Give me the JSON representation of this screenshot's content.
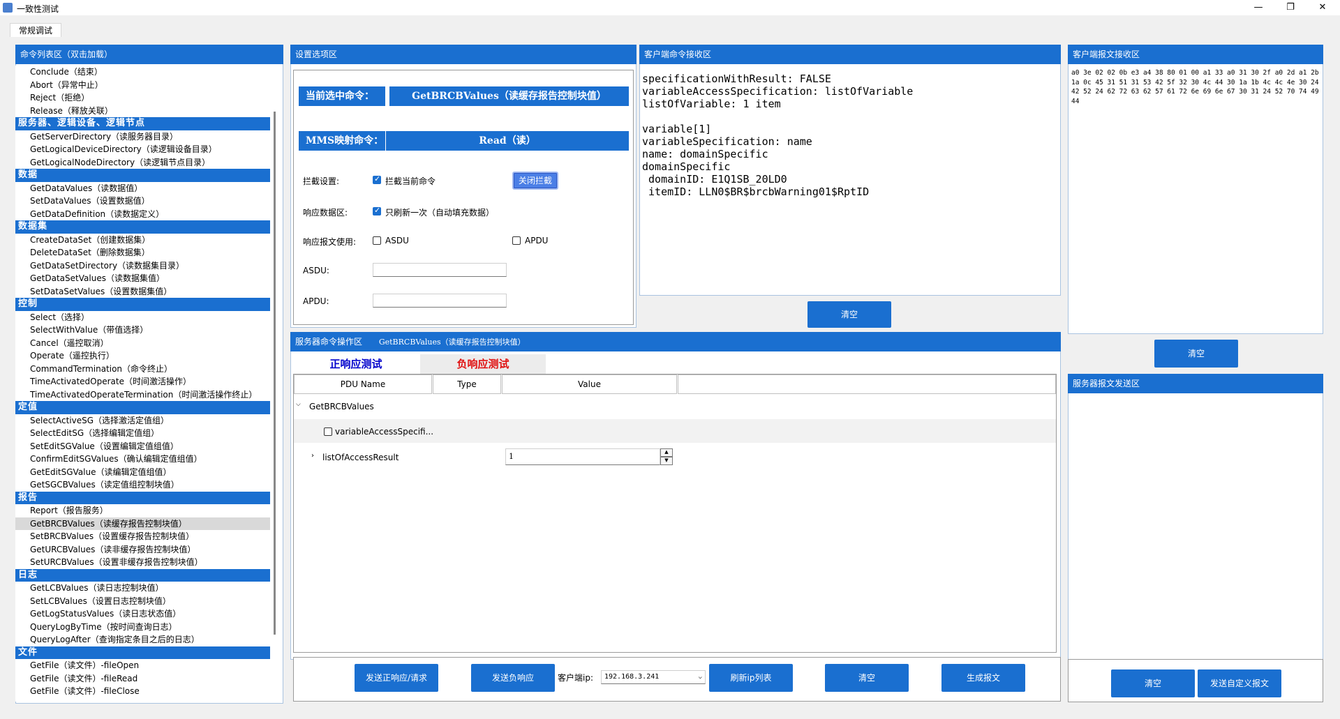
{
  "window": {
    "title": "一致性测试",
    "minimize": "—",
    "restore": "❐",
    "close": "✕"
  },
  "tabs": [
    {
      "label": "常规调试"
    }
  ],
  "command_list": {
    "header": "命令列表区（双击加载）",
    "items": [
      {
        "type": "item",
        "label": "Conclude（结束）"
      },
      {
        "type": "item",
        "label": "Abort（异常中止）"
      },
      {
        "type": "item",
        "label": "Reject（拒绝）"
      },
      {
        "type": "item",
        "label": "Release（释放关联）"
      },
      {
        "type": "group",
        "label": "服务器、逻辑设备、逻辑节点"
      },
      {
        "type": "item",
        "label": "GetServerDirectory（读服务器目录）"
      },
      {
        "type": "item",
        "label": "GetLogicalDeviceDirectory（读逻辑设备目录）"
      },
      {
        "type": "item",
        "label": "GetLogicalNodeDirectory（读逻辑节点目录）"
      },
      {
        "type": "group",
        "label": "数据"
      },
      {
        "type": "item",
        "label": "GetDataValues（读数据值）"
      },
      {
        "type": "item",
        "label": "SetDataValues（设置数据值）"
      },
      {
        "type": "item",
        "label": "GetDataDefinition（读数据定义）"
      },
      {
        "type": "group",
        "label": "数据集"
      },
      {
        "type": "item",
        "label": "CreateDataSet（创建数据集）"
      },
      {
        "type": "item",
        "label": "DeleteDataSet（删除数据集）"
      },
      {
        "type": "item",
        "label": "GetDataSetDirectory（读数据集目录）"
      },
      {
        "type": "item",
        "label": "GetDataSetValues（读数据集值）"
      },
      {
        "type": "item",
        "label": "SetDataSetValues（设置数据集值）"
      },
      {
        "type": "group",
        "label": "控制"
      },
      {
        "type": "item",
        "label": "Select（选择）"
      },
      {
        "type": "item",
        "label": "SelectWithValue（带值选择）"
      },
      {
        "type": "item",
        "label": "Cancel（遥控取消）"
      },
      {
        "type": "item",
        "label": "Operate（遥控执行）"
      },
      {
        "type": "item",
        "label": "CommandTermination（命令终止）"
      },
      {
        "type": "item",
        "label": "TimeActivatedOperate（时间激活操作）"
      },
      {
        "type": "item",
        "label": "TimeActivatedOperateTermination（时间激活操作终止）"
      },
      {
        "type": "group",
        "label": "定值"
      },
      {
        "type": "item",
        "label": "SelectActiveSG（选择激活定值组）"
      },
      {
        "type": "item",
        "label": "SelectEditSG（选择编辑定值组）"
      },
      {
        "type": "item",
        "label": "SetEditSGValue（设置编辑定值组值）"
      },
      {
        "type": "item",
        "label": "ConfirmEditSGValues（确认编辑定值组值）"
      },
      {
        "type": "item",
        "label": "GetEditSGValue（读编辑定值组值）"
      },
      {
        "type": "item",
        "label": "GetSGCBValues（读定值组控制块值）"
      },
      {
        "type": "group",
        "label": "报告"
      },
      {
        "type": "item",
        "label": "Report（报告服务）"
      },
      {
        "type": "item",
        "label": "GetBRCBValues（读缓存报告控制块值）",
        "selected": true
      },
      {
        "type": "item",
        "label": "SetBRCBValues（设置缓存报告控制块值）"
      },
      {
        "type": "item",
        "label": "GetURCBValues（读非缓存报告控制块值）"
      },
      {
        "type": "item",
        "label": "SetURCBValues（设置非缓存报告控制块值）"
      },
      {
        "type": "group",
        "label": "日志"
      },
      {
        "type": "item",
        "label": "GetLCBValues（读日志控制块值）"
      },
      {
        "type": "item",
        "label": "SetLCBValues（设置日志控制块值）"
      },
      {
        "type": "item",
        "label": "GetLogStatusValues（读日志状态值）"
      },
      {
        "type": "item",
        "label": "QueryLogByTime（按时间查询日志）"
      },
      {
        "type": "item",
        "label": "QueryLogAfter（查询指定条目之后的日志）"
      },
      {
        "type": "group",
        "label": "文件"
      },
      {
        "type": "item",
        "label": "GetFile（读文件）-fileOpen"
      },
      {
        "type": "item",
        "label": "GetFile（读文件）-fileRead"
      },
      {
        "type": "item",
        "label": "GetFile（读文件）-fileClose"
      }
    ]
  },
  "settings": {
    "header": "设置选项区",
    "current_cmd_label": "当前选中命令：",
    "current_cmd_value": "GetBRCBValues（读缓存报告控制块值）",
    "mms_label": "MMS映射命令：",
    "mms_value": "Read（读）",
    "intercept_label": "拦截设置:",
    "intercept_check": "拦截当前命令",
    "intercept_checked": true,
    "intercept_button": "关闭拦截",
    "resp_area_label": "响应数据区:",
    "resp_once_check": "只刷新一次（自动填充数据）",
    "resp_once_checked": true,
    "resp_use_label": "响应报文使用:",
    "asdu_check": "ASDU",
    "asdu_checked": false,
    "apdu_check": "APDU",
    "apdu_checked": false,
    "asdu_field_label": "ASDU:",
    "asdu_value": "",
    "apdu_field_label": "APDU:",
    "apdu_value": ""
  },
  "client_recv": {
    "header": "客户端命令接收区",
    "text": "specificationWithResult: FALSE\nvariableAccessSpecification: listOfVariable\nlistOfVariable: 1 item\n\nvariable[1]\nvariableSpecification: name\nname: domainSpecific\ndomainSpecific\n domainID: E1Q1SB_20LD0\n itemID: LLN0$BR$brcbWarning01$RptID",
    "clear_button": "清空"
  },
  "client_packet": {
    "header": "客户端报文接收区",
    "hex": "a0 3e 02 02 0b e3 a4 38 80 01 00 a1 33 a0 31 30 2f a0 2d a1 2b 1a 0c 45 31 51 31 53 42 5f 32 30 4c 44 30 1a 1b 4c 4c 4e 30 24 42 52 24 62 72 63 62 57 61 72 6e 69 6e 67 30 31 24 52 70 74 49 44",
    "clear_button": "清空"
  },
  "server_send": {
    "header": "服务器报文发送区",
    "clear_button": "清空",
    "send_custom_button": "发送自定义报文"
  },
  "server_ops": {
    "header": "服务器命令操作区",
    "header_cmd": "GetBRCBValues（读缓存报告控制块值）",
    "tab_positive": "正响应测试",
    "tab_negative": "负响应测试",
    "tab_positive_color": "#0000cc",
    "tab_negative_color": "#e01010",
    "columns": [
      "PDU Name",
      "Type",
      "Value"
    ],
    "tree": {
      "root": "GetBRCBValues",
      "child1": "variableAccessSpecifi...",
      "child1_checked": false,
      "child2": "listOfAccessResult",
      "child2_value": "1"
    },
    "buttons": {
      "send_pos": "发送正响应/请求",
      "send_neg": "发送负响应",
      "client_ip_label": "客户端ip:",
      "client_ip_value": "192.168.3.241",
      "refresh_ip": "刷新ip列表",
      "clear": "清空",
      "gen_packet": "生成报文"
    }
  },
  "colors": {
    "accent": "#1a6fd0",
    "selected_row": "#d9d9d9",
    "background": "#f0f0f0"
  }
}
